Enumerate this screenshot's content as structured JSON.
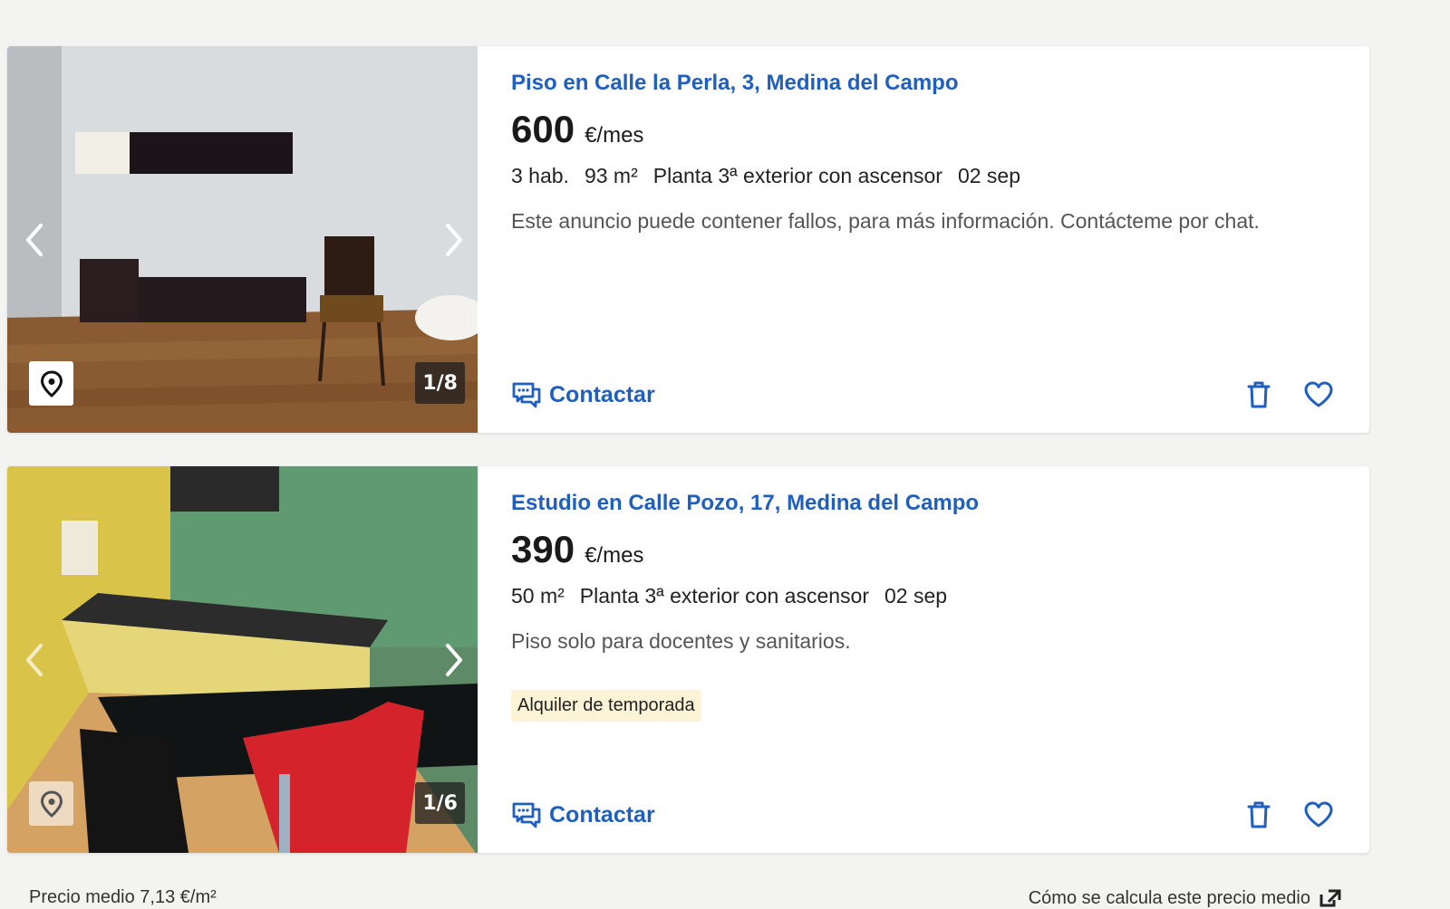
{
  "listings": [
    {
      "title": "Piso en Calle la Perla, 3, Medina del Campo",
      "price": "600",
      "price_unit": "€/mes",
      "details": [
        "3 hab.",
        "93 m²",
        "Planta 3ª exterior con ascensor",
        "02 sep"
      ],
      "description": "Este anuncio puede contener fallos, para más información. Contácteme por chat.",
      "photo_counter": "1/8",
      "contact_label": "Contactar"
    },
    {
      "title": "Estudio en Calle Pozo, 17, Medina del Campo",
      "price": "390",
      "price_unit": "€/mes",
      "details": [
        "50 m²",
        "Planta 3ª exterior con ascensor",
        "02 sep"
      ],
      "description": "Piso solo para docentes y sanitarios.",
      "tag": "Alquiler de temporada",
      "photo_counter": "1/6",
      "contact_label": "Contactar"
    }
  ],
  "footer": {
    "left_text": "Precio medio 7,13 €/m²",
    "right_text": "Cómo se calcula este precio medio"
  },
  "colors": {
    "accent": "#1f5fbf",
    "background": "#f3f3f2",
    "tag_background": "#fdf3d7"
  },
  "icons": {
    "contact": "chat-bubbles-icon",
    "discard": "trash-icon",
    "favorite": "heart-icon",
    "map": "map-pin-icon",
    "prev": "chevron-left-icon",
    "next": "chevron-right-icon"
  }
}
